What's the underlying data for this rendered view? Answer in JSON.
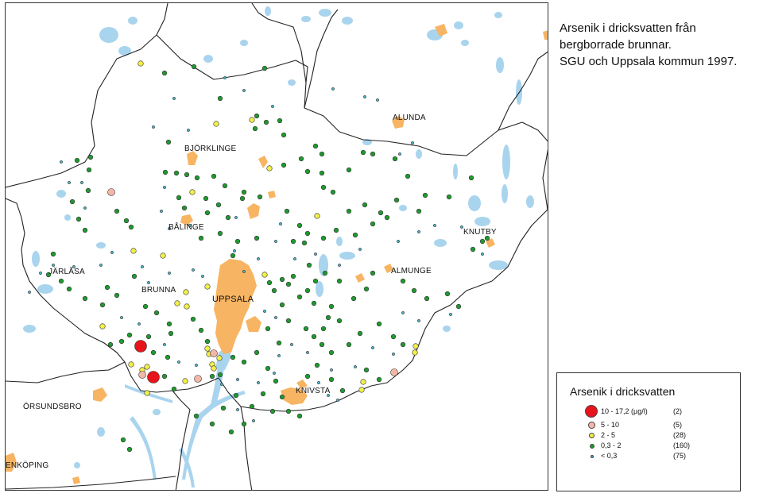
{
  "title": {
    "lines": [
      "Arsenik i dricksvatten från",
      "bergborrade brunnar.",
      "SGU och Uppsala kommun 1997."
    ]
  },
  "legend": {
    "title": "Arsenik i dricksvatten",
    "items": [
      {
        "range": "10   -  17,2 (µg/l)",
        "count": "(2)",
        "color": "#e8141b"
      },
      {
        "range": "5   -  10",
        "count": "(5)",
        "color": "#f4b7a7"
      },
      {
        "range": "2   -   5",
        "count": "(28)",
        "color": "#f2ef4a"
      },
      {
        "range": "0,3 -   2",
        "count": "(160)",
        "color": "#1e9a2e"
      },
      {
        "range": "< 0,3",
        "count": "(75)",
        "color": "#3fb6c9"
      }
    ]
  },
  "places": {
    "alunda": "ALUNDA",
    "bjorklinge": "BJÖRKLINGE",
    "balinge": "BÅLINGE",
    "knutby": "KNUTBY",
    "jarlasa": "JÄRLÅSA",
    "almunge": "ALMUNGE",
    "brunna": "BRUNNA",
    "uppsala": "UPPSALA",
    "knivsta": "KNIVSTA",
    "orsundsbro": "ÖRSUNDSBRO",
    "enkoping": "ENKÖPING"
  },
  "colors": {
    "water": "#a9d4ee",
    "urban": "#f7b462",
    "boundary": "#222222"
  }
}
